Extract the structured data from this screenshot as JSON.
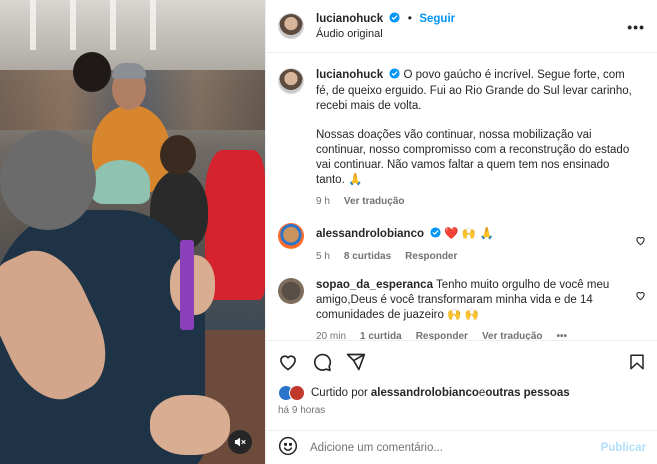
{
  "post": {
    "username": "lucianohuck",
    "follow_label": "Seguir",
    "audio": "Áudio original",
    "more": "•••"
  },
  "caption": {
    "username": "lucianohuck",
    "text_p1": "O povo gaúcho é incrível. Segue forte, com fé, de queixo erguido. Fui ao Rio Grande do Sul levar carinho, recebi mais de volta.",
    "text_p2": "Nossas doações vão continuar, nossa mobilização vai continuar, nosso compromisso com a reconstrução do estado vai continuar. Não vamos faltar a quem tem nos ensinado tanto.",
    "emoji": "🙏",
    "time": "9 h",
    "translate": "Ver tradução"
  },
  "comments": [
    {
      "username": "alessandrolobianco",
      "text": "❤️ 🙌 🙏",
      "time": "5 h",
      "likes": "8 curtidas",
      "reply": "Responder"
    },
    {
      "username": "sopao_da_esperanca",
      "text": "Tenho muito orgulho de você meu amigo,Deus é você transformaram minha vida e de 14 comunidades de juazeiro 🙌 🙌",
      "time": "20 min",
      "likes": "1 curtida",
      "reply": "Responder",
      "translate": "Ver tradução",
      "more": "•••"
    }
  ],
  "likes": {
    "prefix": "Curtido por ",
    "user": "alessandrolobianco",
    "mid": " e ",
    "others": "outras pessoas"
  },
  "posted": "há 9 horas",
  "add_comment": {
    "placeholder": "Adicione um comentário...",
    "publish": "Publicar"
  },
  "colors": {
    "link": "#0095f6",
    "muted": "#737373",
    "publish_disabled": "#b2dffc"
  },
  "icons": [
    "heart-icon",
    "comment-icon",
    "share-icon",
    "bookmark-icon",
    "emoji-icon",
    "verified-badge-icon",
    "mute-icon",
    "more-icon"
  ]
}
